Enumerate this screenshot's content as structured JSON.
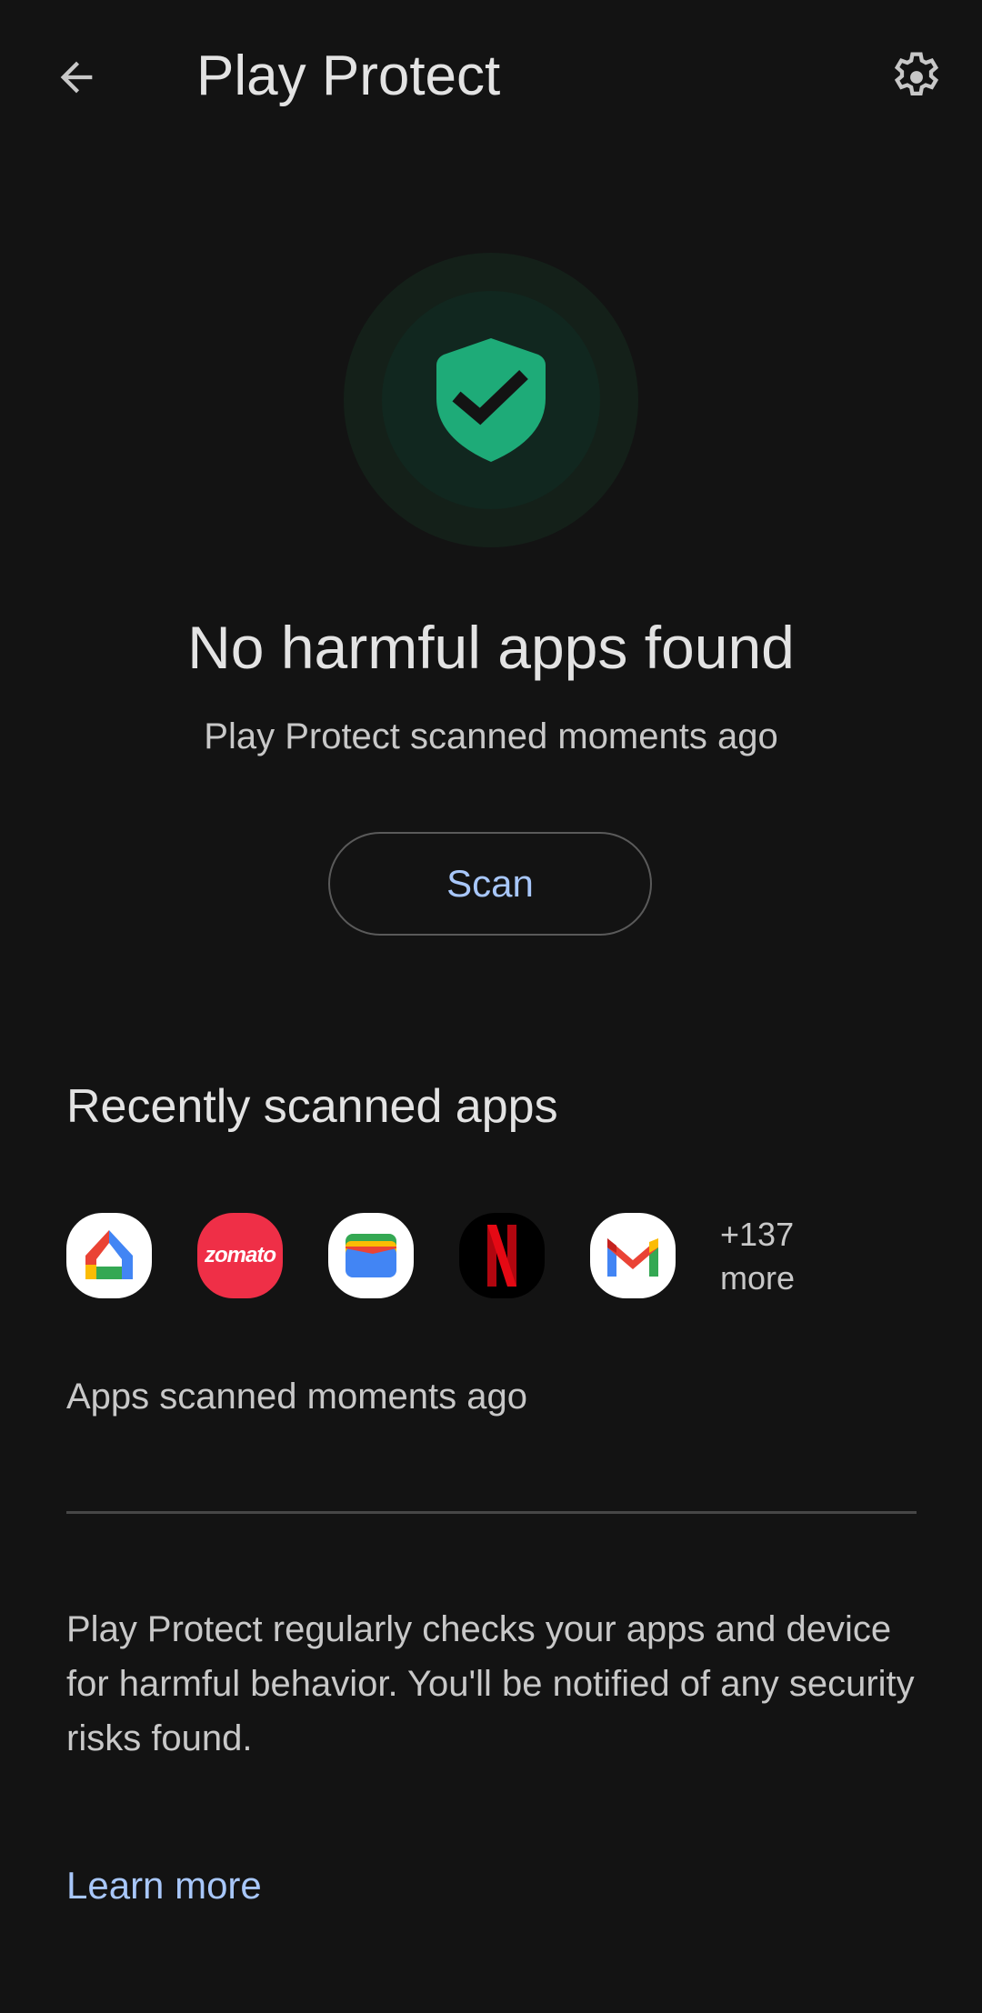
{
  "header": {
    "back_icon": "arrow-left-icon",
    "title": "Play Protect",
    "settings_icon": "gear-icon"
  },
  "status": {
    "icon": "shield-check-icon",
    "headline": "No harmful apps found",
    "subtitle": "Play Protect scanned moments ago",
    "accent_color": "#1eab78"
  },
  "scan_button": {
    "label": "Scan"
  },
  "recent": {
    "title": "Recently scanned apps",
    "apps": [
      {
        "name": "Google Home",
        "icon": "google-home-icon"
      },
      {
        "name": "Zomato",
        "icon": "zomato-icon",
        "label": "zomato"
      },
      {
        "name": "Google Wallet",
        "icon": "google-wallet-icon"
      },
      {
        "name": "Netflix",
        "icon": "netflix-icon"
      },
      {
        "name": "Gmail",
        "icon": "gmail-icon"
      }
    ],
    "more_count": "+137",
    "more_label": "more",
    "scanned_text": "Apps scanned moments ago"
  },
  "description": "Play Protect regularly checks your apps and device for harmful behavior. You'll be notified of any security risks found.",
  "learn_more": "Learn more"
}
